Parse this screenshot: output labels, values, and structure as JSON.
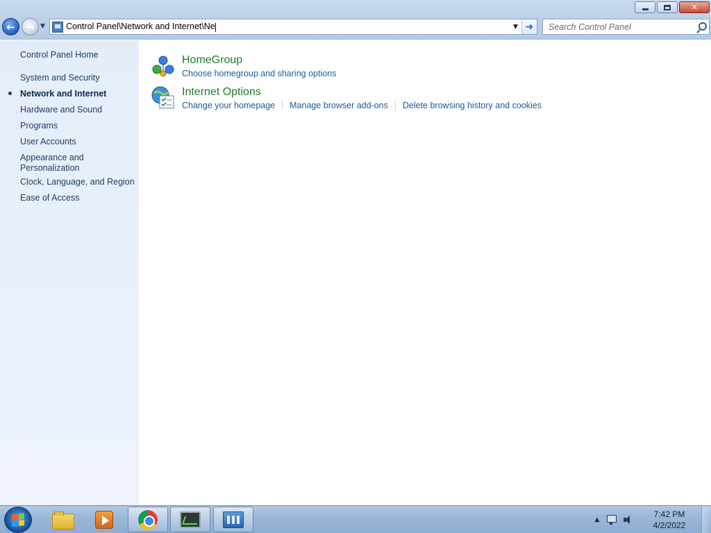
{
  "address_bar": {
    "path": "Control Panel\\Network and Internet\\Ne"
  },
  "search": {
    "placeholder": "Search Control Panel"
  },
  "sidebar": {
    "home": "Control Panel Home",
    "items": [
      {
        "label": "System and Security",
        "current": false
      },
      {
        "label": "Network and Internet",
        "current": true
      },
      {
        "label": "Hardware and Sound",
        "current": false
      },
      {
        "label": "Programs",
        "current": false
      },
      {
        "label": "User Accounts",
        "current": false
      },
      {
        "label": "Appearance and",
        "label2": "Personalization",
        "current": false
      },
      {
        "label": "Clock, Language, and Region",
        "current": false
      },
      {
        "label": "Ease of Access",
        "current": false
      }
    ]
  },
  "categories": [
    {
      "title": "HomeGroup",
      "icon": "homegroup-icon",
      "links": [
        "Choose homegroup and sharing options"
      ]
    },
    {
      "title": "Internet Options",
      "icon": "internet-options-icon",
      "links": [
        "Change your homepage",
        "Manage browser add-ons",
        "Delete browsing history and cookies"
      ]
    }
  ],
  "taskbar": {
    "items": [
      "start-button",
      "explorer-icon",
      "media-player-icon",
      "chrome-icon",
      "task-manager-icon",
      "control-panel-icon"
    ],
    "clock": {
      "time": "7:42 PM",
      "date": "4/2/2022"
    }
  },
  "colors": {
    "link": "#1a5a9c",
    "category_title": "#1e7a2d",
    "sidebar_text": "#1e3a5f"
  }
}
